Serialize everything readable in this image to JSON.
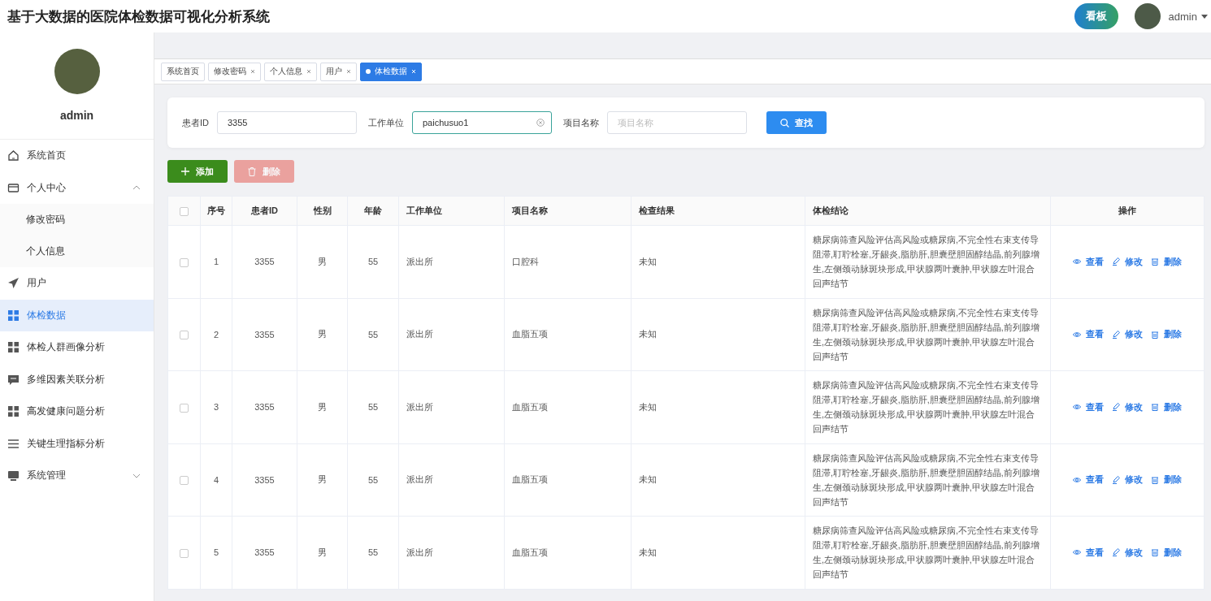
{
  "header": {
    "title": "基于大数据的医院体检数据可视化分析系统",
    "board_button": "看板",
    "user": "admin"
  },
  "sidebar": {
    "profile_name": "admin",
    "items": [
      {
        "label": "系统首页",
        "selected": false
      },
      {
        "label": "个人中心",
        "selected": false,
        "expanded": true,
        "children": [
          {
            "label": "修改密码",
            "selected": false
          },
          {
            "label": "个人信息",
            "selected": false
          }
        ]
      },
      {
        "label": "用户",
        "selected": false
      },
      {
        "label": "体检数据",
        "selected": true
      },
      {
        "label": "体检人群画像分析",
        "selected": false
      },
      {
        "label": "多维因素关联分析",
        "selected": false
      },
      {
        "label": "高发健康问题分析",
        "selected": false
      },
      {
        "label": "关键生理指标分析",
        "selected": false
      },
      {
        "label": "系统管理",
        "selected": false,
        "expanded": false
      }
    ]
  },
  "tabs": [
    {
      "label": "系统首页",
      "selected": false,
      "closable": false
    },
    {
      "label": "修改密码",
      "selected": false,
      "closable": true
    },
    {
      "label": "个人信息",
      "selected": false,
      "closable": true
    },
    {
      "label": "用户",
      "selected": false,
      "closable": true
    },
    {
      "label": "体检数据",
      "selected": true,
      "closable": true
    }
  ],
  "search": {
    "fields": [
      {
        "label": "患者ID",
        "value": "3355",
        "focused": false
      },
      {
        "label": "工作单位",
        "value": "paichusuo1",
        "focused": true
      },
      {
        "label": "项目名称",
        "placeholder": "项目名称",
        "focused": false
      }
    ],
    "button": "查找"
  },
  "actions": [
    {
      "kind": "add",
      "label": "添加",
      "disabled": false
    },
    {
      "kind": "delete",
      "label": "删除",
      "disabled": true
    }
  ],
  "table": {
    "columns": [
      "序号",
      "患者ID",
      "性别",
      "年龄",
      "工作单位",
      "项目名称",
      "检查结果",
      "体检结论",
      "操作"
    ],
    "rows": [
      {
        "checked": false,
        "actions": [
          {
            "kind": "view",
            "label": "查看"
          },
          {
            "kind": "edit",
            "label": "修改"
          },
          {
            "kind": "delete",
            "label": "删除"
          }
        ],
        "cells": [
          "1",
          "3355",
          "男",
          "55",
          "派出所",
          "口腔科",
          "未知",
          "糖尿病筛查风险评估高风险或糖尿病,不完全性右束支传导阻滞,耵聍栓塞,牙龈炎,脂肪肝,胆囊壁胆固醇结晶,前列腺增生,左侧颈动脉斑块形成,甲状腺两叶囊肿,甲状腺左叶混合回声结节"
        ]
      },
      {
        "checked": false,
        "actions": [
          {
            "kind": "view",
            "label": "查看"
          },
          {
            "kind": "edit",
            "label": "修改"
          },
          {
            "kind": "delete",
            "label": "删除"
          }
        ],
        "cells": [
          "2",
          "3355",
          "男",
          "55",
          "派出所",
          "血脂五项",
          "未知",
          "糖尿病筛查风险评估高风险或糖尿病,不完全性右束支传导阻滞,耵聍栓塞,牙龈炎,脂肪肝,胆囊壁胆固醇结晶,前列腺增生,左侧颈动脉斑块形成,甲状腺两叶囊肿,甲状腺左叶混合回声结节"
        ]
      },
      {
        "checked": false,
        "actions": [
          {
            "kind": "view",
            "label": "查看"
          },
          {
            "kind": "edit",
            "label": "修改"
          },
          {
            "kind": "delete",
            "label": "删除"
          }
        ],
        "cells": [
          "3",
          "3355",
          "男",
          "55",
          "派出所",
          "血脂五项",
          "未知",
          "糖尿病筛查风险评估高风险或糖尿病,不完全性右束支传导阻滞,耵聍栓塞,牙龈炎,脂肪肝,胆囊壁胆固醇结晶,前列腺增生,左侧颈动脉斑块形成,甲状腺两叶囊肿,甲状腺左叶混合回声结节"
        ]
      },
      {
        "checked": false,
        "actions": [
          {
            "kind": "view",
            "label": "查看"
          },
          {
            "kind": "edit",
            "label": "修改"
          },
          {
            "kind": "delete",
            "label": "删除"
          }
        ],
        "cells": [
          "4",
          "3355",
          "男",
          "55",
          "派出所",
          "血脂五项",
          "未知",
          "糖尿病筛查风险评估高风险或糖尿病,不完全性右束支传导阻滞,耵聍栓塞,牙龈炎,脂肪肝,胆囊壁胆固醇结晶,前列腺增生,左侧颈动脉斑块形成,甲状腺两叶囊肿,甲状腺左叶混合回声结节"
        ]
      },
      {
        "checked": false,
        "actions": [
          {
            "kind": "view",
            "label": "查看"
          },
          {
            "kind": "edit",
            "label": "修改"
          },
          {
            "kind": "delete",
            "label": "删除"
          }
        ],
        "cells": [
          "5",
          "3355",
          "男",
          "55",
          "派出所",
          "血脂五项",
          "未知",
          "糖尿病筛查风险评估高风险或糖尿病,不完全性右束支传导阻滞,耵聍栓塞,牙龈炎,脂肪肝,胆囊壁胆固醇结晶,前列腺增生,左侧颈动脉斑块形成,甲状腺两叶囊肿,甲状腺左叶混合回声结节"
        ]
      }
    ],
    "all_checked": false
  }
}
